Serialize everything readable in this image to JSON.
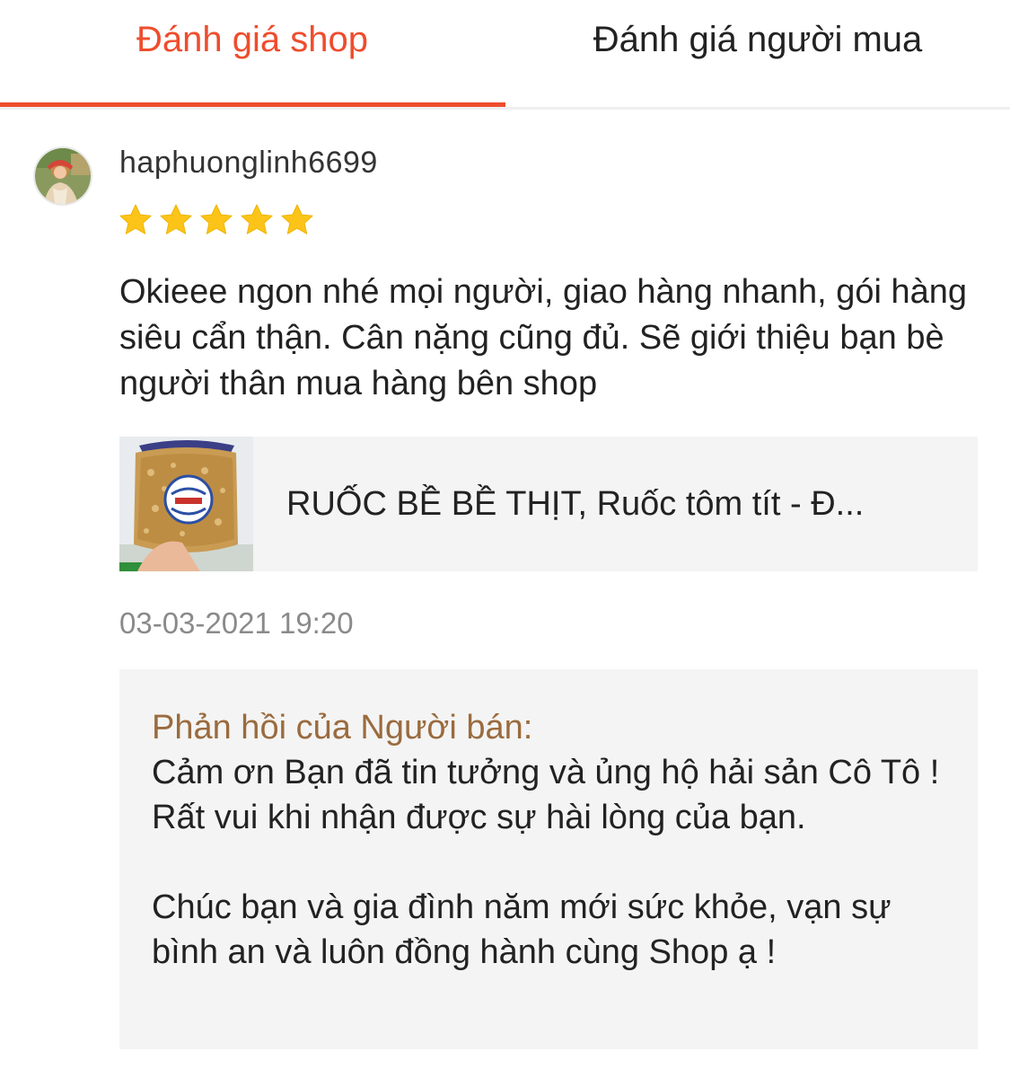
{
  "tabs": {
    "shop_label": "Đánh giá shop",
    "buyer_label": "Đánh giá người mua",
    "active": "shop",
    "accent_color": "#ee4d2d"
  },
  "review": {
    "username": "haphuonglinh6699",
    "rating": 5,
    "rating_max": 5,
    "text": "Okieee ngon nhé mọi người, giao hàng nhanh, gói hàng siêu cẩn thận. Cân nặng cũng đủ. Sẽ giới thiệu bạn bè người thân mua hàng bên shop",
    "product_name": "RUỐC BỀ BỀ THỊT, Ruốc tôm tít - Đ...",
    "date": "03-03-2021 19:20"
  },
  "seller_reply": {
    "title": "Phản hồi của Người bán:",
    "body": "Cảm ơn Bạn đã tin tưởng và ủng hộ hải sản Cô Tô !\nRất vui khi nhận được sự hài lòng của bạn.\n\nChúc bạn và gia đình năm mới sức khỏe, vạn sự bình an và luôn đồng hành cùng Shop ạ !",
    "title_color": "#9a6b3e"
  },
  "icons": {
    "star": "star-icon",
    "avatar": "user-avatar"
  },
  "colors": {
    "star": "#fcc419",
    "panel_bg": "#f4f4f4"
  }
}
